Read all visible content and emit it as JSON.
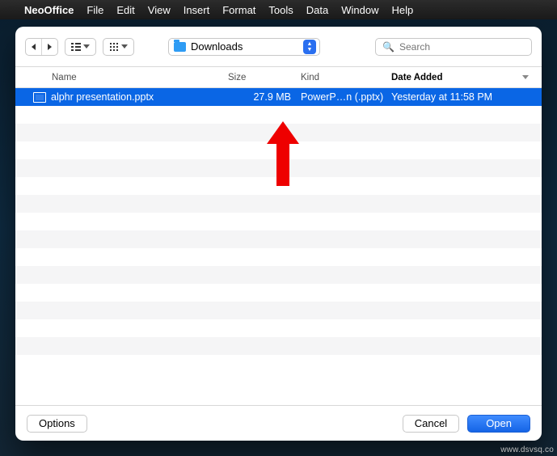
{
  "menubar": {
    "app": "NeoOffice",
    "items": [
      "File",
      "Edit",
      "View",
      "Insert",
      "Format",
      "Tools",
      "Data",
      "Window",
      "Help"
    ]
  },
  "toolbar": {
    "location": "Downloads",
    "search_placeholder": "Search"
  },
  "columns": {
    "name": "Name",
    "size": "Size",
    "kind": "Kind",
    "date": "Date Added"
  },
  "files": [
    {
      "name": "alphr presentation.pptx",
      "size": "27.9 MB",
      "kind": "PowerP…n (.pptx)",
      "date": "Yesterday at 11:58 PM",
      "selected": true
    }
  ],
  "footer": {
    "options": "Options",
    "cancel": "Cancel",
    "open": "Open"
  },
  "watermark": "www.dsvsq.co"
}
